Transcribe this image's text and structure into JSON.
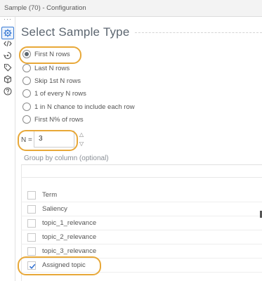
{
  "window": {
    "title": "Sample (70) - Configuration"
  },
  "sidebar": {
    "icons": [
      {
        "name": "gear-icon",
        "active": true
      },
      {
        "name": "code-icon",
        "active": false
      },
      {
        "name": "sample-icon",
        "active": false
      },
      {
        "name": "tag-icon",
        "active": false
      },
      {
        "name": "cube-icon",
        "active": false
      },
      {
        "name": "help-icon",
        "active": false
      }
    ]
  },
  "main": {
    "heading": "Select Sample Type",
    "options": [
      {
        "label": "First N rows",
        "checked": true
      },
      {
        "label": "Last N rows",
        "checked": false
      },
      {
        "label": "Skip 1st N rows",
        "checked": false
      },
      {
        "label": "1 of every N rows",
        "checked": false
      },
      {
        "label": "1 in N chance to include each row",
        "checked": false
      },
      {
        "label": "First N% of rows",
        "checked": false
      }
    ],
    "n_field": {
      "label": "N =",
      "value": "3"
    },
    "group_by": {
      "label": "Group by column (optional)",
      "columns": [
        {
          "label": "Term",
          "checked": false
        },
        {
          "label": "Saliency",
          "checked": false
        },
        {
          "label": "topic_1_relevance",
          "checked": false
        },
        {
          "label": "topic_2_relevance",
          "checked": false
        },
        {
          "label": "topic_3_relevance",
          "checked": false
        },
        {
          "label": "Assigned topic",
          "checked": true
        }
      ]
    }
  },
  "colors": {
    "highlight": "#e8a838",
    "active_icon_border": "#3a7bd5",
    "check_mark": "#2f6fd0"
  }
}
